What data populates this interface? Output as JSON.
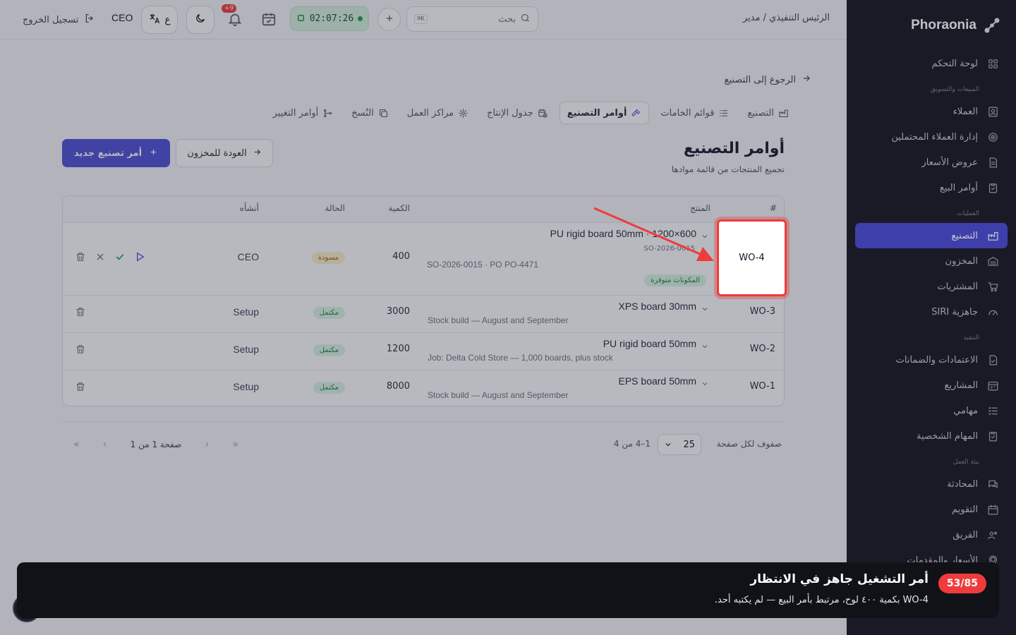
{
  "app": {
    "brand": "Phoraonia"
  },
  "topbar": {
    "breadcrumb": "الرئيس التنفيذي / مدير",
    "search_placeholder": "بحث",
    "search_shortcut": "K⌘",
    "timer": "02:07:26",
    "notif_count": "+9",
    "lang_label": "ع",
    "user": "CEO",
    "logout": "تسجيل الخروج"
  },
  "sidebar": {
    "items": [
      {
        "label": "لوحة التحكم",
        "icon": "dashboard-icon"
      },
      {
        "section": "المبيعات والتسويق"
      },
      {
        "label": "العملاء",
        "icon": "contacts-icon"
      },
      {
        "label": "إدارة العملاء المحتملين",
        "icon": "target-icon"
      },
      {
        "label": "عروض الأسعار",
        "icon": "document-icon"
      },
      {
        "label": "أوامر البيع",
        "icon": "clipboard-icon"
      },
      {
        "section": "العمليات"
      },
      {
        "label": "التصنيع",
        "icon": "factory-icon",
        "active": true
      },
      {
        "label": "المخزون",
        "icon": "warehouse-icon"
      },
      {
        "label": "المشتريات",
        "icon": "cart-icon"
      },
      {
        "label": "جاهزية SIRI",
        "icon": "gauge-icon"
      },
      {
        "section": "التنفيذ"
      },
      {
        "label": "الاعتمادات والضمانات",
        "icon": "file-check-icon"
      },
      {
        "label": "المشاريع",
        "icon": "calendar-grid-icon"
      },
      {
        "label": "مهامي",
        "icon": "list-check-icon"
      },
      {
        "label": "المهام الشخصية",
        "icon": "clipboard-icon"
      },
      {
        "section": "بيئة العمل"
      },
      {
        "label": "المحادثة",
        "icon": "chat-icon"
      },
      {
        "label": "التقويم",
        "icon": "calendar-icon"
      },
      {
        "label": "الفريق",
        "icon": "users-icon"
      },
      {
        "label": "الأسعار والمقدمات",
        "icon": "pin-icon"
      }
    ]
  },
  "page": {
    "back_link": "الرجوع إلى التصنيع",
    "tabs": [
      {
        "label": "التصنيع",
        "icon": "factory-icon"
      },
      {
        "label": "قوائم الخامات",
        "icon": "list-icon"
      },
      {
        "label": "أوامر التصنيع",
        "icon": "hammer-icon",
        "active": true
      },
      {
        "label": "جدول الإنتاج",
        "icon": "calendar-clock-icon"
      },
      {
        "label": "مراكز العمل",
        "icon": "gear-icon"
      },
      {
        "label": "النُسخ",
        "icon": "copy-icon"
      },
      {
        "label": "أوامر التغيير",
        "icon": "git-icon"
      }
    ],
    "title": "أوامر التصنيع",
    "subtitle": "تجميع المنتجات من قائمة موادها",
    "new_button": "أمر تصنيع جديد",
    "back_inventory_button": "العودة للمخزون"
  },
  "table": {
    "headers": {
      "num": "#",
      "product": "المنتج",
      "qty": "الكمية",
      "status": "الحالة",
      "created_by": "أنشأه"
    },
    "rows": [
      {
        "id": "WO-4",
        "product": "PU rigid board 50mm · 1200×600",
        "so_ref": "SO-2026-0015",
        "note": "SO-2026-0015 · PO PO-4471",
        "chip": "المكونات متوفرة",
        "qty": "400",
        "status": "مسودة",
        "status_kind": "draft",
        "created_by": "CEO"
      },
      {
        "id": "WO-3",
        "product": "XPS board 30mm",
        "note": "Stock build — August and September",
        "qty": "3000",
        "status": "مكتمل",
        "status_kind": "done",
        "created_by": "Setup"
      },
      {
        "id": "WO-2",
        "product": "PU rigid board 50mm",
        "note": "Job: Delta Cold Store — 1,000 boards, plus stock",
        "qty": "1200",
        "status": "مكتمل",
        "status_kind": "done",
        "created_by": "Setup"
      },
      {
        "id": "WO-1",
        "product": "EPS board 50mm",
        "note": "Stock build — August and September",
        "qty": "8000",
        "status": "مكتمل",
        "status_kind": "done",
        "created_by": "Setup"
      }
    ]
  },
  "pagination": {
    "rows_per_page_label": "صفوف لكل صفحة",
    "rows_per_page": "25",
    "range": "1–4 من 4",
    "page_label": "صفحة 1 من 1"
  },
  "toast": {
    "step": "53/85",
    "title": "أمر التشغيل جاهز في الانتظار",
    "body": "WO-4 بكمية ٤٠٠ لوح، مرتبط بأمر البيع — لم يكتبه أحد."
  },
  "colors": {
    "accent": "#4d4fd6",
    "sidebar": "#1e1f2c",
    "highlight": "#ef3b3b",
    "timer_bg": "#d7f3df"
  }
}
